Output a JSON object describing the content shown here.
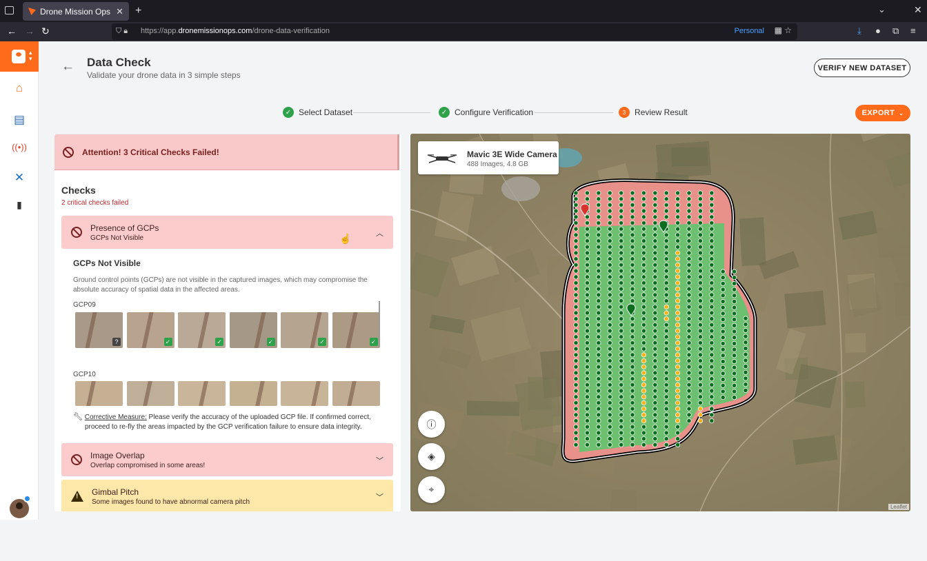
{
  "browser": {
    "tab_title": "Drone Mission Ops",
    "url_prefix": "https://app.",
    "url_domain": "dronemissionops.com",
    "url_path": "/drone-data-verification",
    "profile_label": "Personal"
  },
  "header": {
    "title": "Data Check",
    "subtitle": "Validate your drone data in 3 simple steps",
    "verify_button": "VERIFY NEW DATASET",
    "export_button": "EXPORT"
  },
  "stepper": {
    "steps": [
      {
        "label": "Select Dataset",
        "state": "done"
      },
      {
        "label": "Configure Verification",
        "state": "done"
      },
      {
        "number": "3",
        "label": "Review Result",
        "state": "active"
      }
    ]
  },
  "alert": {
    "text": "Attention! 3 Critical Checks Failed!"
  },
  "checks": {
    "title": "Checks",
    "subtitle": "2 critical checks failed",
    "items": [
      {
        "title": "Presence of GCPs",
        "subtitle": "GCPs Not Visible",
        "severity": "critical",
        "expanded": true
      },
      {
        "title": "Image Overlap",
        "subtitle": "Overlap compromised in some areas!",
        "severity": "critical",
        "expanded": false
      },
      {
        "title": "Gimbal Pitch",
        "subtitle": "Some images found to have abnormal camera pitch",
        "severity": "warning",
        "expanded": false
      }
    ],
    "detail": {
      "title": "GCPs Not Visible",
      "description": "Ground control points (GCPs) are not visible in the captured images, which may compromise the absolute accuracy of spatial data in the affected areas.",
      "gcp_groups": [
        {
          "label": "GCP09",
          "statuses": [
            "unknown",
            "ok",
            "ok",
            "ok",
            "ok",
            "ok"
          ]
        },
        {
          "label": "GCP10",
          "statuses": [
            "none",
            "none",
            "none",
            "none",
            "none",
            "none"
          ]
        }
      ],
      "corrective_label": "Corrective Measure:",
      "corrective_text": " Please verify the accuracy of the uploaded GCP file. If confirmed correct,",
      "corrective_text2": "proceed to re-fly the areas impacted by the GCP verification failure to ensure data integrity."
    }
  },
  "map": {
    "camera_name": "Mavic 3E Wide Camera",
    "camera_stats": "488 Images, 4.8 GB",
    "attribution": "Leaflet",
    "colors": {
      "ok_point": "#0a6e1e",
      "warn_point": "#f7b21b",
      "coverage_good": "#6cc070",
      "coverage_bad": "#e8908a"
    }
  }
}
